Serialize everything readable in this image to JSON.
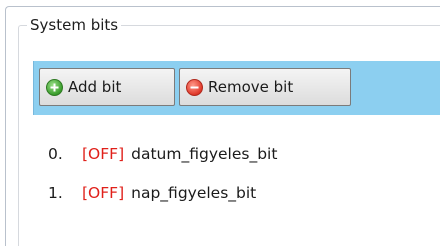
{
  "groupbox": {
    "title": "System bits"
  },
  "toolbar": {
    "add_label": "Add bit",
    "remove_label": "Remove bit"
  },
  "bits": [
    {
      "index": "0.",
      "state": "[OFF]",
      "name": "datum_figyeles_bit"
    },
    {
      "index": "1.",
      "state": "[OFF]",
      "name": "nap_figyeles_bit"
    }
  ],
  "colors": {
    "toolbar_bg": "#8ccff0",
    "off_state": "#e0201a"
  }
}
